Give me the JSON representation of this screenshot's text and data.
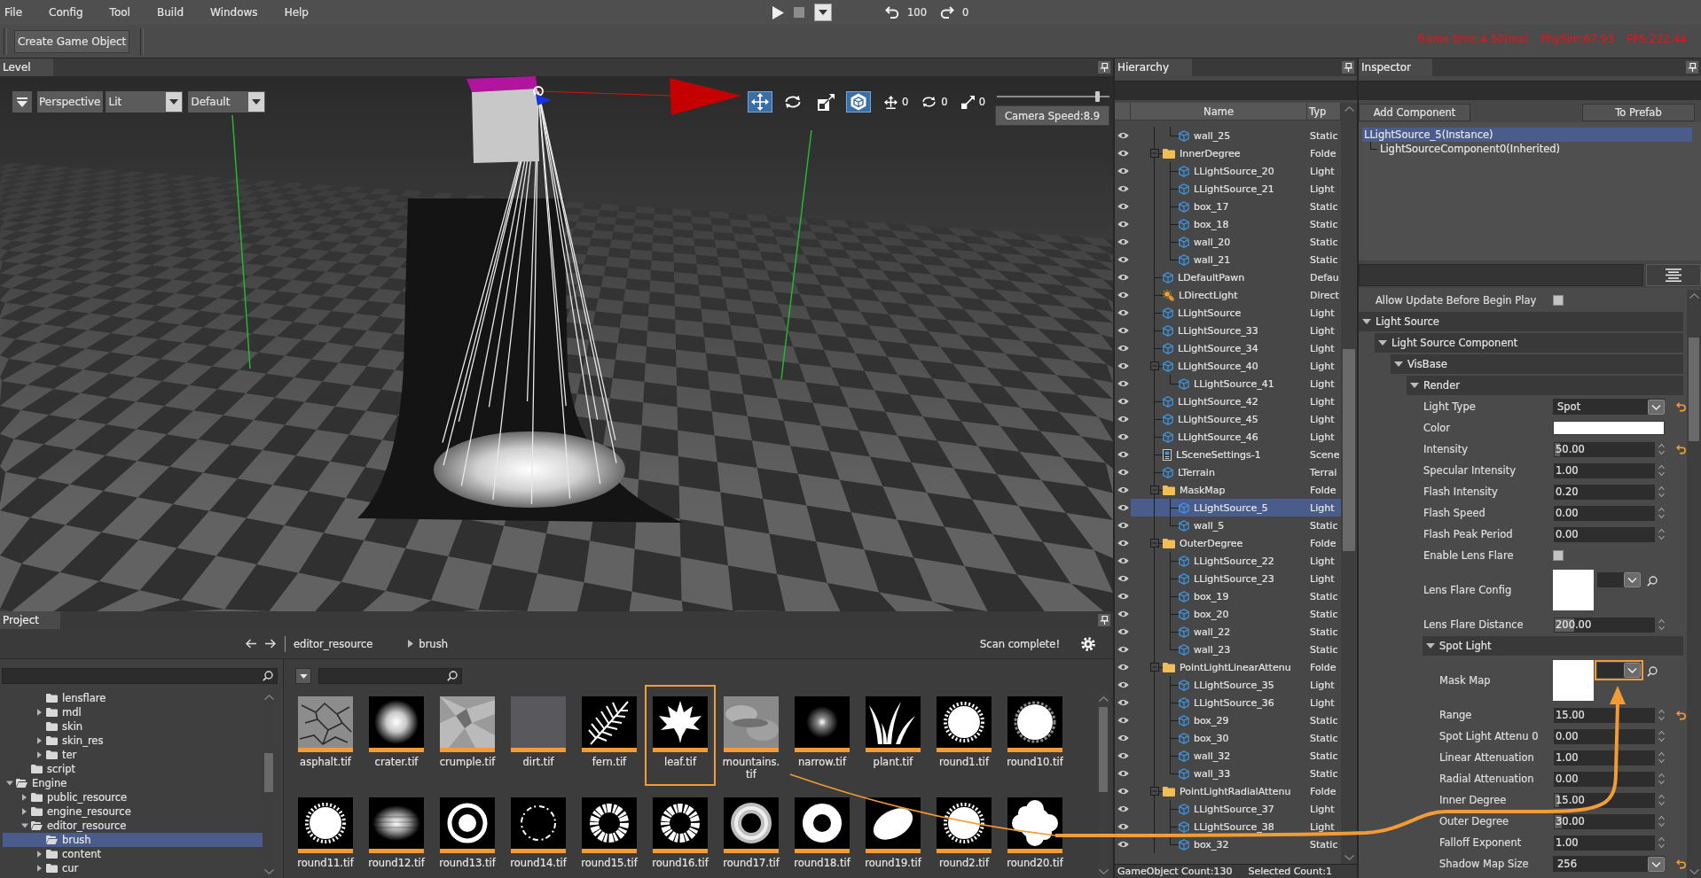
{
  "menu": {
    "items": [
      "File",
      "Config",
      "Tool",
      "Build",
      "Windows",
      "Help"
    ]
  },
  "playback": {
    "undo_count": "100",
    "redo_count": "0"
  },
  "toolbar": {
    "buttons": [
      "Create Game Object"
    ],
    "stats": [
      "frame time:4.50(ms)",
      "PhySim:67.93",
      "FPS:222.44"
    ]
  },
  "level": {
    "tab": "Level",
    "projection": "Perspective",
    "shading": "Lit",
    "layout": "Default",
    "tools": [
      {
        "kind": "move",
        "selected": true
      },
      {
        "kind": "rotate",
        "selected": false
      },
      {
        "kind": "scale",
        "selected": false
      },
      {
        "kind": "space",
        "selected": true
      }
    ],
    "snaps": [
      {
        "kind": "move",
        "value": "0"
      },
      {
        "kind": "rotate",
        "value": "0"
      },
      {
        "kind": "scale",
        "value": "0"
      }
    ],
    "camera_speed": {
      "level": 0.9,
      "label": "Camera Speed:8.9"
    }
  },
  "hierarchy": {
    "tab": "Hierarchy",
    "columns": [
      "Name",
      "Typ"
    ],
    "tree": [
      {
        "children": [
          {
            "children": [
              {
                "name": "wall_25",
                "type": "Static",
                "kind": "object",
                "selected": false
              }
            ]
          },
          {
            "name": "InnerDegree",
            "type": "Folde",
            "kind": "folder",
            "expanded": true,
            "selected": false,
            "children": [
              {
                "name": "LLightSource_20",
                "type": "Light",
                "kind": "object",
                "selected": false
              },
              {
                "name": "LLightSource_21",
                "type": "Light",
                "kind": "object",
                "selected": false
              },
              {
                "name": "box_17",
                "type": "Static",
                "kind": "object",
                "selected": false
              },
              {
                "name": "box_18",
                "type": "Static",
                "kind": "object",
                "selected": false
              },
              {
                "name": "wall_20",
                "type": "Static",
                "kind": "object",
                "selected": false
              },
              {
                "name": "wall_21",
                "type": "Static",
                "kind": "object",
                "selected": false
              }
            ]
          },
          {
            "name": "LDefaultPawn",
            "type": "Defau",
            "kind": "object",
            "selected": false
          },
          {
            "name": "LDirectLight",
            "type": "Direct",
            "kind": "sun",
            "selected": false
          },
          {
            "name": "LLightSource",
            "type": "Light",
            "kind": "object",
            "selected": false
          },
          {
            "name": "LLightSource_33",
            "type": "Light",
            "kind": "object",
            "selected": false
          },
          {
            "name": "LLightSource_34",
            "type": "Light",
            "kind": "object",
            "selected": false
          },
          {
            "name": "LLightSource_40",
            "type": "Light",
            "kind": "object",
            "expanded": true,
            "selected": false,
            "children": [
              {
                "name": "LLightSource_41",
                "type": "Light",
                "kind": "object",
                "selected": false
              }
            ]
          },
          {
            "name": "LLightSource_42",
            "type": "Light",
            "kind": "object",
            "selected": false
          },
          {
            "name": "LLightSource_45",
            "type": "Light",
            "kind": "object",
            "selected": false
          },
          {
            "name": "LLightSource_46",
            "type": "Light",
            "kind": "object",
            "selected": false
          },
          {
            "name": "LSceneSettings-1",
            "type": "Scene",
            "kind": "settings",
            "selected": false
          },
          {
            "name": "LTerrain",
            "type": "Terrai",
            "kind": "object",
            "selected": false
          },
          {
            "name": "MaskMap",
            "type": "Folde",
            "kind": "folder",
            "expanded": true,
            "selected": false,
            "children": [
              {
                "name": "LLightSource_5",
                "type": "Light",
                "kind": "object",
                "selected": true
              },
              {
                "name": "wall_5",
                "type": "Static",
                "kind": "object",
                "selected": false
              }
            ]
          },
          {
            "name": "OuterDegree",
            "type": "Folde",
            "kind": "folder",
            "expanded": true,
            "selected": false,
            "children": [
              {
                "name": "LLightSource_22",
                "type": "Light",
                "kind": "object",
                "selected": false
              },
              {
                "name": "LLightSource_23",
                "type": "Light",
                "kind": "object",
                "selected": false
              },
              {
                "name": "box_19",
                "type": "Static",
                "kind": "object",
                "selected": false
              },
              {
                "name": "box_20",
                "type": "Static",
                "kind": "object",
                "selected": false
              },
              {
                "name": "wall_22",
                "type": "Static",
                "kind": "object",
                "selected": false
              },
              {
                "name": "wall_23",
                "type": "Static",
                "kind": "object",
                "selected": false
              }
            ]
          },
          {
            "name": "PointLightLinearAttenu",
            "type": "Folde",
            "kind": "folder",
            "expanded": true,
            "selected": false,
            "children": [
              {
                "name": "LLightSource_35",
                "type": "Light",
                "kind": "object",
                "selected": false
              },
              {
                "name": "LLightSource_36",
                "type": "Light",
                "kind": "object",
                "selected": false
              },
              {
                "name": "box_29",
                "type": "Static",
                "kind": "object",
                "selected": false
              },
              {
                "name": "box_30",
                "type": "Static",
                "kind": "object",
                "selected": false
              },
              {
                "name": "wall_32",
                "type": "Static",
                "kind": "object",
                "selected": false
              },
              {
                "name": "wall_33",
                "type": "Static",
                "kind": "object",
                "selected": false
              }
            ]
          },
          {
            "name": "PointLightRadialAttenu",
            "type": "Folde",
            "kind": "folder",
            "expanded": true,
            "selected": false,
            "children": [
              {
                "name": "LLightSource_37",
                "type": "Light",
                "kind": "object",
                "selected": false
              },
              {
                "name": "LLightSource_38",
                "type": "Light",
                "kind": "object",
                "selected": false
              },
              {
                "name": "box_32",
                "type": "Static",
                "kind": "object",
                "selected": false
              }
            ]
          }
        ]
      }
    ],
    "status": [
      "GameObject Count:130",
      "Selected Count:1"
    ]
  },
  "inspector": {
    "tab": "Inspector",
    "buttons": [
      "Add Component",
      "To Prefab"
    ],
    "components": [
      {
        "name": "LLightSource_5(Instance)",
        "selected": true,
        "children": [
          {
            "name": "LightSourceComponent0(Inherited)",
            "selected": false
          }
        ]
      }
    ],
    "properties": [
      {
        "kind": "checkbox",
        "label": "Allow Update Before Begin Play",
        "checked": false
      },
      {
        "kind": "section",
        "label": "Light Source",
        "expanded": true,
        "children": [
          {
            "kind": "section",
            "label": "Light Source Component",
            "expanded": true,
            "children": [
              {
                "kind": "section",
                "label": "VisBase",
                "expanded": true,
                "children": [
                  {
                    "kind": "section",
                    "label": "Render",
                    "expanded": true,
                    "children": [
                      {
                        "kind": "select",
                        "label": "Light Type",
                        "value": "Spot",
                        "modified": true
                      },
                      {
                        "kind": "color",
                        "label": "Color",
                        "color": "#ffffff",
                        "modified": false
                      },
                      {
                        "kind": "number",
                        "label": "Intensity",
                        "value": "50.00",
                        "level": 0.05,
                        "modified": true
                      },
                      {
                        "kind": "number",
                        "label": "Specular Intensity",
                        "value": "1.00",
                        "modified": false
                      },
                      {
                        "kind": "number",
                        "label": "Flash Intensity",
                        "value": "0.20",
                        "modified": false
                      },
                      {
                        "kind": "number",
                        "label": "Flash Speed",
                        "value": "0.00",
                        "modified": false
                      },
                      {
                        "kind": "number",
                        "label": "Flash Peak Period",
                        "value": "0.00",
                        "modified": false
                      },
                      {
                        "kind": "checkbox",
                        "label": "Enable Lens Flare",
                        "checked": false
                      },
                      {
                        "kind": "asset",
                        "label": "Lens Flare Config",
                        "highlighted": false
                      },
                      {
                        "kind": "number",
                        "label": "Lens Flare Distance",
                        "value": "200.00",
                        "level": 0.19,
                        "modified": false
                      },
                      {
                        "kind": "section",
                        "label": "Spot Light",
                        "expanded": true,
                        "children": [
                          {
                            "kind": "asset",
                            "label": "Mask Map",
                            "highlighted": true
                          },
                          {
                            "kind": "number",
                            "label": "Range",
                            "value": "15.00",
                            "modified": true
                          },
                          {
                            "kind": "number",
                            "label": "Spot Light Attenu 0",
                            "value": "0.00",
                            "modified": false
                          },
                          {
                            "kind": "number",
                            "label": "Linear Attenuation",
                            "value": "1.00",
                            "modified": false
                          },
                          {
                            "kind": "number",
                            "label": "Radial Attenuation",
                            "value": "0.00",
                            "modified": false
                          },
                          {
                            "kind": "number",
                            "label": "Inner Degree",
                            "value": "15.00",
                            "level": 0.04,
                            "modified": false
                          },
                          {
                            "kind": "number",
                            "label": "Outer Degree",
                            "value": "30.00",
                            "level": 0.07,
                            "modified": false
                          },
                          {
                            "kind": "number",
                            "label": "Falloff Exponent",
                            "value": "1.00",
                            "modified": false
                          },
                          {
                            "kind": "select",
                            "label": "Shadow Map Size",
                            "value": "256",
                            "modified": true
                          }
                        ]
                      }
                    ]
                  }
                ]
              }
            ]
          }
        ]
      }
    ]
  },
  "project": {
    "tab": "Project",
    "path": [
      "editor_resource",
      "brush"
    ],
    "status": "Scan complete!",
    "folders": [
      {
        "children": [
          {
            "children": [
              {
                "name": "lensflare",
                "selected": false
              },
              {
                "name": "mdl",
                "expanded": false,
                "selected": false
              },
              {
                "name": "skin",
                "selected": false
              },
              {
                "name": "skin_res",
                "expanded": false,
                "selected": false
              },
              {
                "name": "ter",
                "expanded": false,
                "selected": false
              }
            ]
          },
          {
            "name": "script",
            "selected": false
          }
        ]
      },
      {
        "name": "Engine",
        "expanded": true,
        "selected": false,
        "children": [
          {
            "name": "public_resource",
            "expanded": false,
            "selected": false
          },
          {
            "name": "engine_resource",
            "expanded": false,
            "selected": false
          },
          {
            "name": "editor_resource",
            "expanded": true,
            "selected": false,
            "children": [
              {
                "name": "brush",
                "selected": true
              },
              {
                "name": "content",
                "expanded": false,
                "selected": false
              },
              {
                "name": "cur",
                "expanded": false,
                "selected": false
              }
            ]
          }
        ]
      }
    ],
    "assets": [
      {
        "name": "asphalt.tif",
        "highlighted": false
      },
      {
        "name": "crater.tif",
        "highlighted": false
      },
      {
        "name": "crumple.tif",
        "highlighted": false
      },
      {
        "name": "dirt.tif",
        "highlighted": false
      },
      {
        "name": "fern.tif",
        "highlighted": false
      },
      {
        "name": "leaf.tif",
        "highlighted": true
      },
      {
        "name": "mountains.tif",
        "highlighted": false
      },
      {
        "name": "narrow.tif",
        "highlighted": false
      },
      {
        "name": "plant.tif",
        "highlighted": false
      },
      {
        "name": "round1.tif",
        "highlighted": false
      },
      {
        "name": "round10.tif",
        "highlighted": false
      },
      {
        "name": "round11.tif",
        "highlighted": false
      },
      {
        "name": "round12.tif",
        "highlighted": false
      },
      {
        "name": "round13.tif",
        "highlighted": false
      },
      {
        "name": "round14.tif",
        "highlighted": false
      },
      {
        "name": "round15.tif",
        "highlighted": false
      },
      {
        "name": "round16.tif",
        "highlighted": false
      },
      {
        "name": "round17.tif",
        "highlighted": false
      },
      {
        "name": "round18.tif",
        "highlighted": false
      },
      {
        "name": "round19.tif",
        "highlighted": false
      },
      {
        "name": "round2.tif",
        "highlighted": false
      },
      {
        "name": "round20.tif",
        "highlighted": false
      }
    ]
  }
}
